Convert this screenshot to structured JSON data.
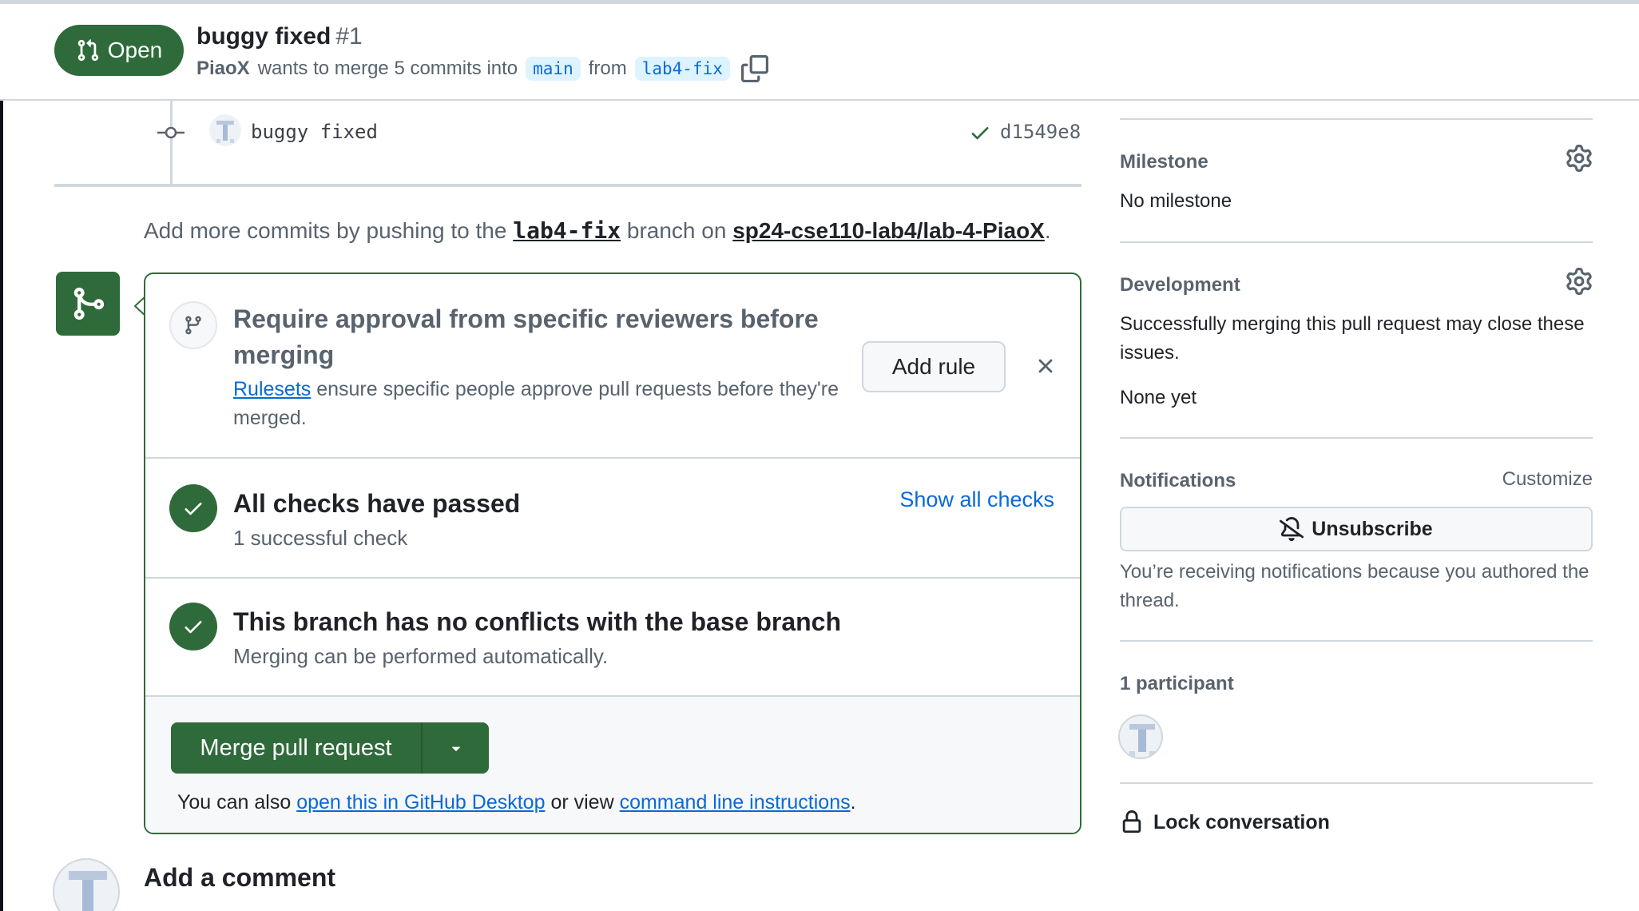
{
  "header": {
    "state": "Open",
    "title": "buggy fixed",
    "number": "#1",
    "author": "PiaoX",
    "merge_text": "wants to merge 5 commits into",
    "base_branch": "main",
    "from_text": "from",
    "head_branch": "lab4-fix"
  },
  "commit": {
    "message": "buggy fixed",
    "sha": "d1549e8"
  },
  "push_hint": {
    "prefix": "Add more commits by pushing to the",
    "branch": "lab4-fix",
    "middle": "branch on",
    "repo": "sp24-cse110-lab4/lab-4-PiaoX",
    "suffix": "."
  },
  "merge_box": {
    "rule_title": "Require approval from specific reviewers before merging",
    "rule_link": "Rulesets",
    "rule_desc": "ensure specific people approve pull requests before they're merged.",
    "add_rule_label": "Add rule",
    "checks_title": "All checks have passed",
    "checks_sub": "1 successful check",
    "show_checks_label": "Show all checks",
    "conflicts_title": "This branch has no conflicts with the base branch",
    "conflicts_sub": "Merging can be performed automatically.",
    "merge_button_label": "Merge pull request",
    "also_prefix": "You can also",
    "desktop_link": "open this in GitHub Desktop",
    "also_middle": "or view",
    "cli_link": "command line instructions",
    "also_suffix": "."
  },
  "comment": {
    "heading": "Add a comment"
  },
  "sidebar": {
    "milestone_heading": "Milestone",
    "milestone_value": "No milestone",
    "development_heading": "Development",
    "development_text": "Successfully merging this pull request may close these issues.",
    "development_value": "None yet",
    "notifications_heading": "Notifications",
    "customize_label": "Customize",
    "unsubscribe_label": "Unsubscribe",
    "notifications_reason": "You’re receiving notifications because you authored the thread.",
    "participants_heading": "1 participant",
    "lock_label": "Lock conversation"
  },
  "colors": {
    "success_green": "#2f6b3a",
    "link_blue": "#0969da",
    "branch_bg": "#ddf4ff",
    "border": "#d0d7de"
  },
  "icons": [
    "git-pull-request-icon",
    "copy-icon",
    "commit-icon",
    "check-icon",
    "git-merge-icon",
    "git-branch-icon",
    "close-icon",
    "triangle-down-icon",
    "gear-icon",
    "bell-slash-icon",
    "lock-icon"
  ]
}
